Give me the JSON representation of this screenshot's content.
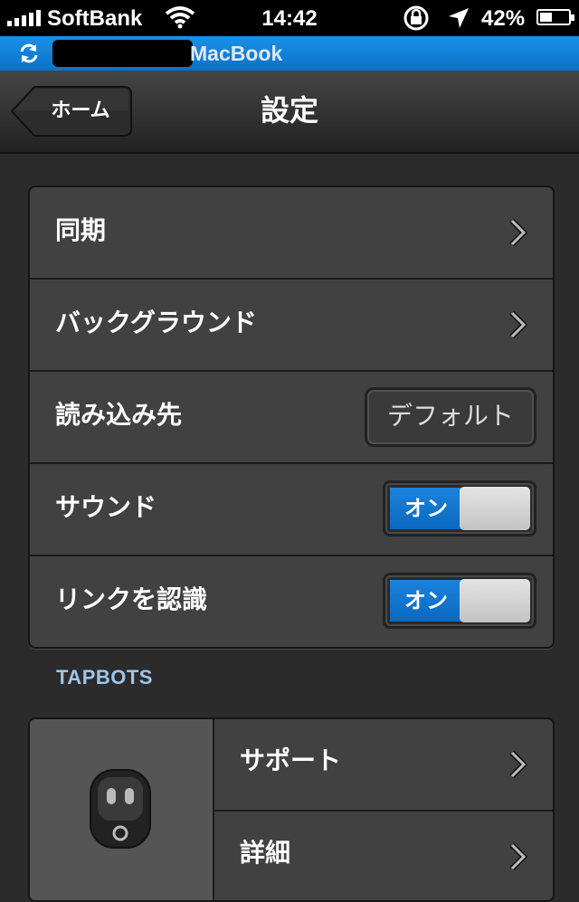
{
  "status_bar": {
    "carrier": "SoftBank",
    "time": "14:42",
    "battery": "42%",
    "battery_level": 0.42,
    "icons": [
      "signal-icon",
      "wifi-icon",
      "rotation-lock-icon",
      "location-icon",
      "battery-icon"
    ]
  },
  "sync_bar": {
    "device_name": "MacBook",
    "icon": "sync-icon"
  },
  "nav": {
    "back_label": "ホーム",
    "title": "設定"
  },
  "settings": {
    "rows": [
      {
        "label": "同期",
        "accessory": "chevron"
      },
      {
        "label": "バックグラウンド",
        "accessory": "chevron"
      },
      {
        "label": "読み込み先",
        "accessory": "value",
        "value": "デフォルト"
      },
      {
        "label": "サウンド",
        "accessory": "toggle",
        "toggle_label": "オン",
        "on": true
      },
      {
        "label": "リンクを認識",
        "accessory": "toggle",
        "toggle_label": "オン",
        "on": true
      }
    ]
  },
  "tapbots": {
    "header": "TAPBOTS",
    "rows": [
      {
        "label": "サポート"
      },
      {
        "label": "詳細"
      }
    ]
  },
  "colors": {
    "accent_blue": "#0a72c8",
    "header_text": "#9dc6ec",
    "background": "#2b2b2b"
  }
}
